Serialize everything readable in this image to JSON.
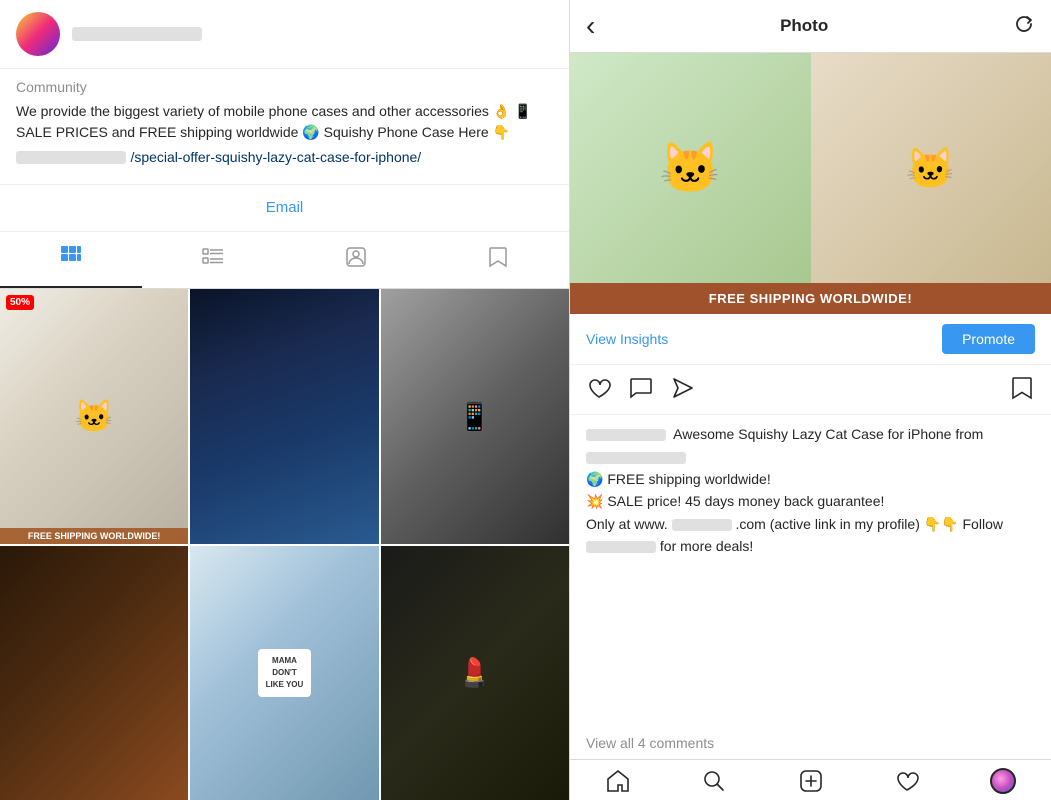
{
  "left": {
    "profile": {
      "name_blurred": true,
      "category": "Community",
      "bio_text": "We provide the biggest variety of mobile phone cases and other accessories 👌 📱 SALE PRICES and FREE shipping worldwide 🌍 Squishy Phone Case Here 👇",
      "link_prefix_blurred": true,
      "link_text": "/special-offer-squishy-lazy-cat-case-for-iphone/",
      "email_label": "Email"
    },
    "tabs": [
      {
        "id": "grid",
        "label": "Grid view",
        "active": true
      },
      {
        "id": "list",
        "label": "List view",
        "active": false
      },
      {
        "id": "tag",
        "label": "Tagged view",
        "active": false
      },
      {
        "id": "saved",
        "label": "Saved view",
        "active": false
      }
    ],
    "grid_badge": "50%",
    "free_shipping": "FREE SHIPPING WORLDWIDE!",
    "mama_text_line1": "MAMA",
    "mama_text_line2": "DON'T",
    "mama_text_line3": "LIKE YOU"
  },
  "right": {
    "header": {
      "title": "Photo",
      "back_label": "‹",
      "refresh_label": "↺"
    },
    "photo": {
      "free_shipping_bar": "FREE SHIPPING WORLDWIDE!"
    },
    "actions": {
      "view_insights": "View Insights",
      "promote": "Promote"
    },
    "caption": {
      "username_blurred": true,
      "text_part1": "Awesome Squishy Lazy Cat Case for iPhone from",
      "username2_blurred": true,
      "text_part2": "🌍 FREE shipping worldwide! 💥 SALE price! 45 days money back guarantee! Only at www.",
      "domain_blurred": true,
      "text_part3": ".com (active link in my profile) 👇👇 Follow",
      "username3_blurred": true,
      "text_part4": "for more deals!"
    },
    "comments": {
      "view_all": "View all 4 comments"
    },
    "nav": {
      "home_icon": "⌂",
      "search_icon": "🔍",
      "add_icon": "+",
      "heart_icon": "♡",
      "profile_label": "profile"
    }
  }
}
